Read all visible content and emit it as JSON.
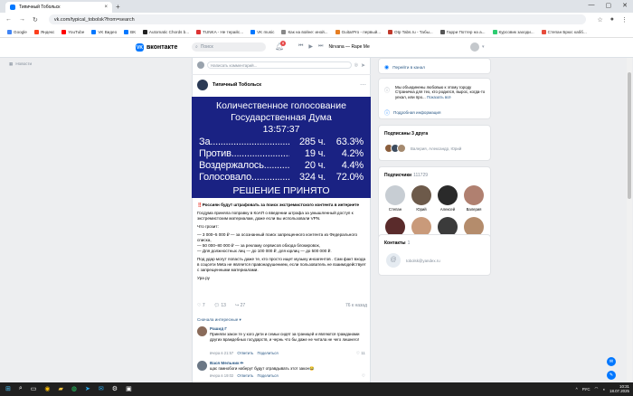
{
  "browser": {
    "tab_title": "Типичный Тобольск",
    "new_tab": "+",
    "url": "vk.com/typical_tobolsk?from=search",
    "window_controls": [
      "—",
      "▢",
      "✕"
    ],
    "bookmarks": [
      {
        "label": "Google",
        "color": "#4285f4"
      },
      {
        "label": "Яндекс",
        "color": "#fc3f1d"
      },
      {
        "label": "YouTube",
        "color": "#ff0000"
      },
      {
        "label": "VK Видео",
        "color": "#0077ff"
      },
      {
        "label": "ВК",
        "color": "#0077ff"
      },
      {
        "label": "Automatic Chords b...",
        "color": "#222"
      },
      {
        "label": "TUNKA - Не терайс...",
        "color": "#d33"
      },
      {
        "label": "VK music",
        "color": "#0077ff"
      },
      {
        "label": "Как на войне: иной...",
        "color": "#888"
      },
      {
        "label": "GuitarPro - первый...",
        "color": "#e67e22"
      },
      {
        "label": "Otp Tabs.ru - Табы...",
        "color": "#c0392b"
      },
      {
        "label": "Гарри Поттер на а...",
        "color": "#555"
      },
      {
        "label": "Курсовик заходи...",
        "color": "#2ecc71"
      },
      {
        "label": "Степан Брюс кабб...",
        "color": "#e74c3c"
      }
    ]
  },
  "vk": {
    "logo": "вконтакте",
    "search_placeholder": "Поиск",
    "notif_count": "8",
    "now_playing": "Nirvana — Rape Me",
    "left_menu_item": "Новости"
  },
  "post": {
    "comment_placeholder": "Написать комментарий...",
    "author": "Типичный Тобольск",
    "vote": {
      "title1": "Количественное голосование",
      "title2": "Государственная Дума",
      "time": "13:57:37",
      "rows": [
        {
          "label": "За",
          "value": "285 ч.",
          "pct": "63.3%"
        },
        {
          "label": "Против",
          "value": "19 ч.",
          "pct": "4.2%"
        },
        {
          "label": "Воздержалось",
          "value": "20 ч.",
          "pct": "4.4%"
        },
        {
          "label": "Голосовало",
          "value": "324 ч.",
          "pct": "72.0%"
        }
      ],
      "result": "РЕШЕНИЕ ПРИНЯТО"
    },
    "paragraphs": [
      "‼️Россиян будут штрафовать за поиск экстремистского контента в интернете",
      "Госдума приняла поправку в КоАП о введении штрафа за умышленный доступ к экстремистским материалам, даже если вы использовали VPN.",
      "Что грозит:",
      "— 3 000–5 000 ₽ — за осознанный поиск запрещенного контента из Федерального списка,",
      "— 50 000–80 000 ₽ — за рекламу сервисов обхода блокировок,",
      "— Для должностных лиц — до 100 000 ₽, для юрлиц — до 500 000 ₽.",
      "Под удар могут попасть даже те, кто просто ищет музыку иноагентов . Сам факт входа в соцсети Meta не является правонарушением, если пользователь не взаимодействует с запрещенными материалами.",
      "Ура ру"
    ],
    "likes": "7",
    "comments": "13",
    "reposts": "27",
    "views": "76 к назад",
    "show_interesting": "Сначала интересные",
    "comment_list": [
      {
        "name": "Рашид Г",
        "text": "Приняли закон те у кого дети и семьи сидят за границей и являются гражданами других враждебных государств, и чернь что бы даже не читала не чего лишнего!",
        "time": "вчера в 21:57",
        "reply": "Ответить",
        "share": "Поделиться",
        "likes": "11"
      },
      {
        "name": "Вася Мельник",
        "text": "щас гамнобоги наберут будут отравдывать этот закон😂",
        "time": "вчера в 19:02",
        "reply": "Ответить",
        "share": "Поделиться",
        "likes": ""
      }
    ]
  },
  "right": {
    "goto_channel": "Перейти в канал",
    "about": "Мы объединены любовью к этому городу Страничка для тех, кто родился, вырос, когда-то уехал, или про...",
    "about_more": "Показать всё",
    "detailed_info": "Подробная информация",
    "friends_title": "Подписаны 3 друга",
    "friends_names": "Валерия, Александр, Юрий",
    "subs_title": "Подписчики",
    "subs_count": "111729",
    "subscribers": [
      "Степан",
      "Юрий",
      "Алексей",
      "Валерия",
      "Наталья",
      "Юлия",
      "Натали",
      "Елизавета"
    ],
    "contacts_title": "Контакты",
    "contacts_count": "1",
    "contact_email": "tobolsk@yandex.ru"
  },
  "taskbar": {
    "lang": "РУС",
    "time": "10:31",
    "date": "18.07.2025"
  },
  "colors": {
    "vk_blue": "#0077ff",
    "vote_bg": "#1a2283",
    "link": "#2a5885"
  }
}
